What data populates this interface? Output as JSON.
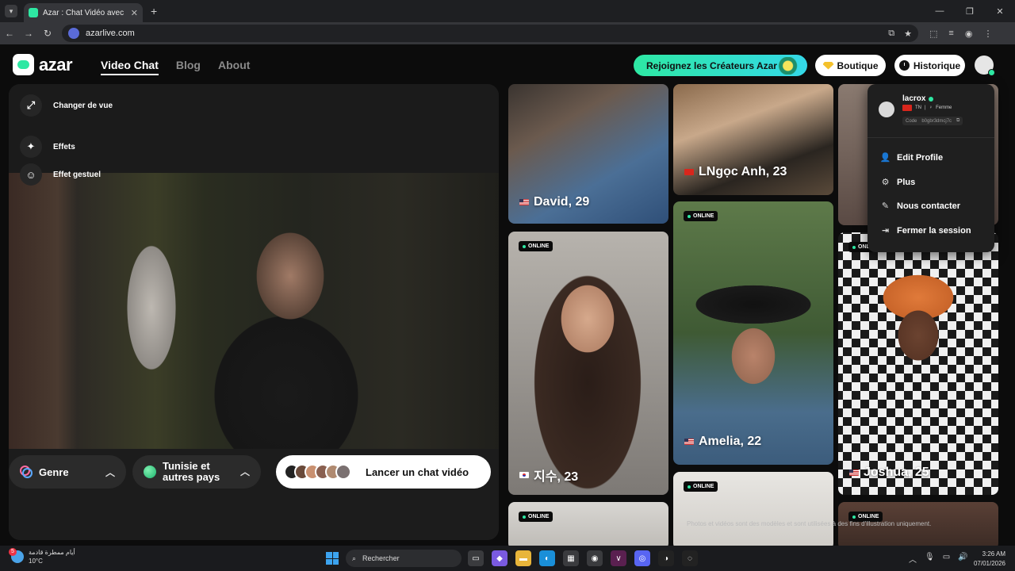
{
  "browser": {
    "tab_title": "Azar : Chat Vidéo avec de n",
    "url": "azarlive.com"
  },
  "header": {
    "logo_text": "azar",
    "nav": [
      "Video Chat",
      "Blog",
      "About"
    ],
    "creators_label": "Rejoignez les Créateurs Azar",
    "boutique_label": "Boutique",
    "historique_label": "Historique"
  },
  "video_panel": {
    "controls": [
      "Changer de vue",
      "Effets",
      "Effet gestuel"
    ],
    "genre_label": "Genre",
    "country_label_line1": "Tunisie et",
    "country_label_line2": "autres pays",
    "launch_label": "Lancer un chat vidéo"
  },
  "gallery": {
    "online_label": "ONLINE",
    "cards": [
      {
        "name": "David, 29",
        "flag": "us"
      },
      {
        "name": "LNgọc Anh, 23",
        "flag": "vn"
      },
      {
        "name": "지수, 23",
        "flag": "kr"
      },
      {
        "name": "Amelia, 22",
        "flag": "us"
      },
      {
        "name": "Joshua, 25",
        "flag": "us"
      }
    ],
    "disclaimer": "Photos et vidéos sont des modèles et sont utilisées à des fins d'illustration uniquement."
  },
  "profile_menu": {
    "username": "lacrox",
    "country": "TN",
    "gender": "Femme",
    "code_label": "Code",
    "code_value": "b0gbr3dmcj7c",
    "items": [
      "Edit Profile",
      "Plus",
      "Nous contacter",
      "Fermer la session"
    ]
  },
  "taskbar": {
    "weather_line1": "أيام ممطرة قادمة",
    "weather_line2": "10°C",
    "weather_badge": "5",
    "search_label": "Rechercher",
    "time": "3:26 AM",
    "date": "07/01/2026"
  },
  "colors": {
    "accent": "#2ee8a3",
    "background": "#0c0c0c"
  }
}
